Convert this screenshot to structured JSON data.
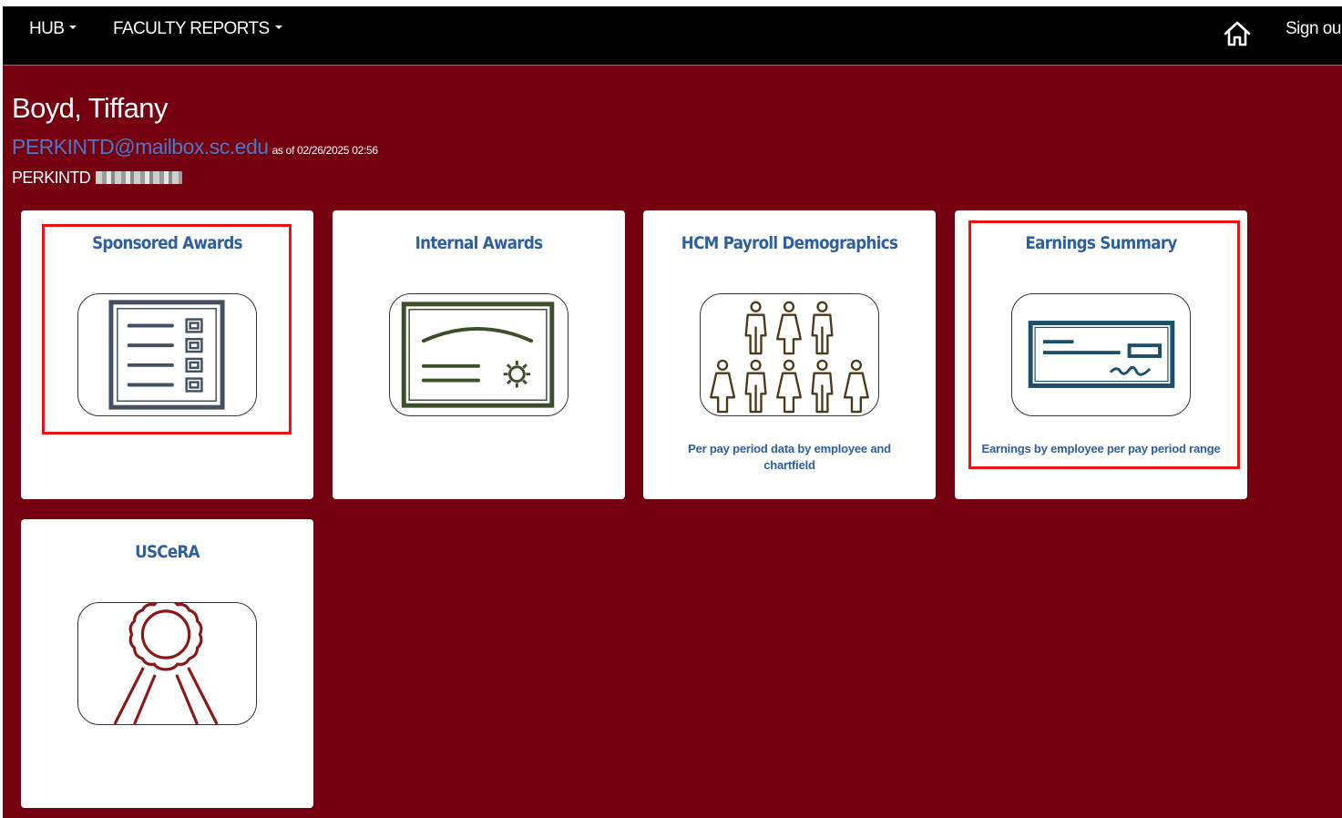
{
  "nav": {
    "menus": [
      {
        "label": "HUB"
      },
      {
        "label": "FACULTY REPORTS"
      }
    ],
    "home_icon": "home-icon",
    "signout_label": "Sign ou"
  },
  "user": {
    "name": "Boyd, Tiffany",
    "email": "PERKINTD@mailbox.sc.edu",
    "as_of": "as of 02/26/2025 02:56",
    "id": "PERKINTD"
  },
  "tiles": [
    {
      "title": "Sponsored Awards",
      "description": "",
      "icon": "checklist-icon",
      "highlighted": true
    },
    {
      "title": "Internal Awards",
      "description": "",
      "icon": "certificate-icon",
      "highlighted": false
    },
    {
      "title": "HCM Payroll Demographics",
      "description": "Per pay period data by employee and chartfield",
      "icon": "people-group-icon",
      "highlighted": false
    },
    {
      "title": "Earnings Summary",
      "description": "Earnings by employee per pay period range",
      "icon": "paycheck-icon",
      "highlighted": true
    },
    {
      "title": "USCeRA",
      "description": "",
      "icon": "ribbon-award-icon",
      "highlighted": false
    }
  ],
  "colors": {
    "background": "#750010",
    "navbar": "#000000",
    "tile_title": "#2e5f9e",
    "email": "#4a78c9",
    "highlight": "#ee1111"
  }
}
